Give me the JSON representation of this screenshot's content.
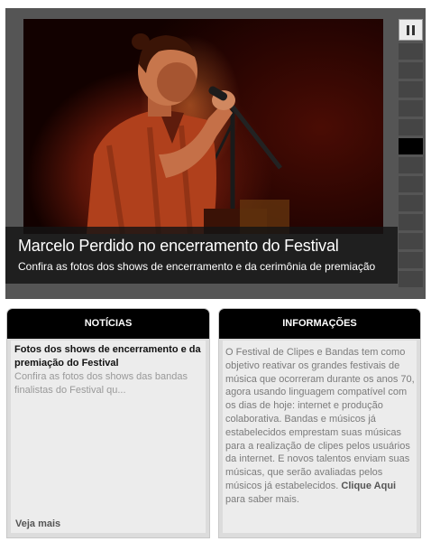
{
  "slider": {
    "slide_title": "Marcelo Perdido no encerramento do Festival",
    "slide_subtitle": "Confira as fotos dos shows de encerramento e da cerimônia de premiação",
    "pause_icon": "pause-icon",
    "thumbnail_count": 13,
    "active_thumbnail": 6
  },
  "noticias": {
    "header": "NOTÍCIAS",
    "item_title": "Fotos dos shows de encerramento e da premiação do Festival",
    "item_description": "Confira as fotos dos shows das bandas finalistas do Festival qu...",
    "see_more": "Veja mais"
  },
  "informacoes": {
    "header": "INFORMAÇÕES",
    "text": "O Festival de Clipes e Bandas tem como objetivo reativar os grandes festivais de música que ocorreram durante os anos 70, agora usando linguagem compatível com os dias de hoje: internet e produção colaborativa. Bandas e músicos já estabelecidos emprestam suas músicas para a realização de clipes pelos usuários da internet. E novos talentos enviam suas músicas, que serão avaliadas pelos músicos já estabelecidos.",
    "link_label": "Clique Aqui",
    "link_suffix": "para saber mais."
  },
  "colors": {
    "panel_header": "#000000",
    "panel_bg": "#dcdcdc",
    "slider_bg": "#555555",
    "photo_tone": "#8a2a14"
  }
}
